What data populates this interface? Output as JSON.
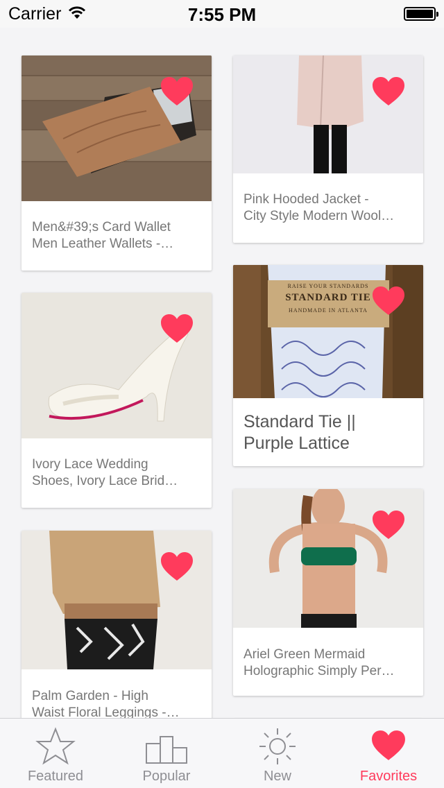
{
  "status_bar": {
    "carrier": "Carrier",
    "time": "7:55 PM"
  },
  "colors": {
    "accent": "#ff3b5c",
    "tab_inactive": "#8e8e93"
  },
  "products": [
    {
      "title_line1": "Men&#39;s Card Wallet",
      "title_line2": "Men Leather Wallets -…",
      "favorited": true
    },
    {
      "title_line1": "Pink Hooded Jacket -",
      "title_line2": "City Style Modern Wool…",
      "favorited": true
    },
    {
      "title_line1": "Ivory Lace Wedding",
      "title_line2": "Shoes, Ivory Lace Brid…",
      "favorited": true
    },
    {
      "title_line1": "Standard Tie ||",
      "title_line2": "Purple Lattice",
      "favorited": true
    },
    {
      "title_line1": "Palm Garden  - High",
      "title_line2": "Waist Floral Leggings -…",
      "favorited": true
    },
    {
      "title_line1": "Ariel Green Mermaid",
      "title_line2": "Holographic Simply Per…",
      "favorited": true
    }
  ],
  "tie_label": {
    "top": "RAISE YOUR STANDARDS",
    "main": "STANDARD TIE",
    "bottom": "HANDMADE IN ATLANTA"
  },
  "tabs": [
    {
      "label": "Featured",
      "icon": "star-icon"
    },
    {
      "label": "Popular",
      "icon": "podium-icon"
    },
    {
      "label": "New",
      "icon": "sun-icon"
    },
    {
      "label": "Favorites",
      "icon": "heart-icon",
      "active": true
    }
  ]
}
